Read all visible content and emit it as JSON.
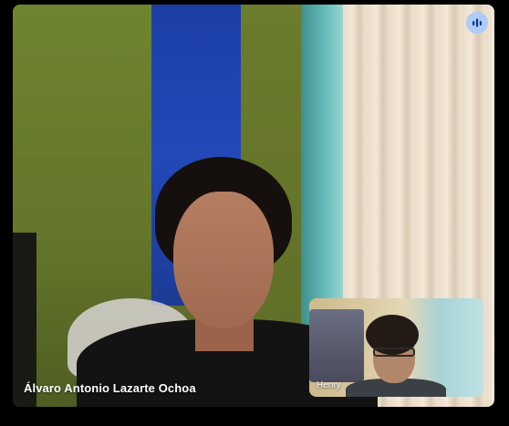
{
  "participants": {
    "main": {
      "name": "Álvaro Antonio Lazarte Ochoa"
    },
    "self_view": {
      "name": "Henry"
    }
  },
  "controls": {
    "audio_indicator_icon": "audio-level-icon",
    "accent_color": "#aecbfa"
  }
}
